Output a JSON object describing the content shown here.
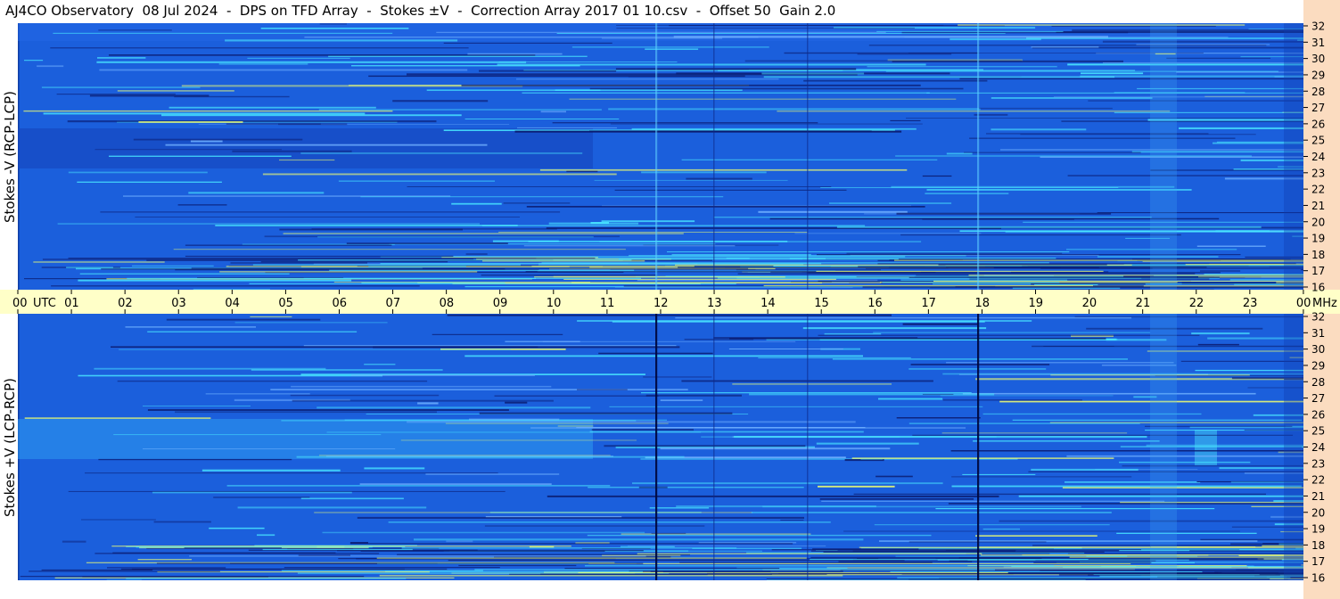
{
  "title": "AJ4CO Observatory  08 Jul 2024  -  DPS on TFD Array  -  Stokes ±V  -  Correction Array 2017 01 10.csv  -  Offset 50  Gain 2.0",
  "chart_data": [
    {
      "type": "heatmap",
      "panel": "top",
      "ylabel": "Stokes -V (RCP-LCP)",
      "yticks": [
        "16",
        "17",
        "18",
        "19",
        "20",
        "21",
        "22",
        "23",
        "24",
        "25",
        "26",
        "27",
        "28",
        "29",
        "30",
        "31",
        "32"
      ],
      "ylim": [
        16,
        32
      ],
      "xlim": [
        0,
        24
      ],
      "colors": {
        "background": "#1b5fdc",
        "low": "#0a1a6e",
        "high": "#49e6ff",
        "hot": "#f0ff70"
      }
    },
    {
      "type": "heatmap",
      "panel": "bottom",
      "ylabel": "Stokes +V (LCP-RCP)",
      "yticks": [
        "16",
        "17",
        "18",
        "19",
        "20",
        "21",
        "22",
        "23",
        "24",
        "25",
        "26",
        "27",
        "28",
        "29",
        "30",
        "31",
        "32"
      ],
      "ylim": [
        16,
        32
      ],
      "xlim": [
        0,
        24
      ],
      "colors": {
        "background": "#1b5fdc",
        "low": "#0a1a6e",
        "high": "#49e6ff",
        "hot": "#f0ff70"
      }
    }
  ],
  "time_axis": {
    "ticks": [
      "00",
      "01",
      "02",
      "03",
      "04",
      "05",
      "06",
      "07",
      "08",
      "09",
      "10",
      "11",
      "12",
      "13",
      "14",
      "15",
      "16",
      "17",
      "18",
      "19",
      "20",
      "21",
      "22",
      "23",
      "00"
    ],
    "utc_label": "UTC",
    "mhz_label": "MHz"
  }
}
